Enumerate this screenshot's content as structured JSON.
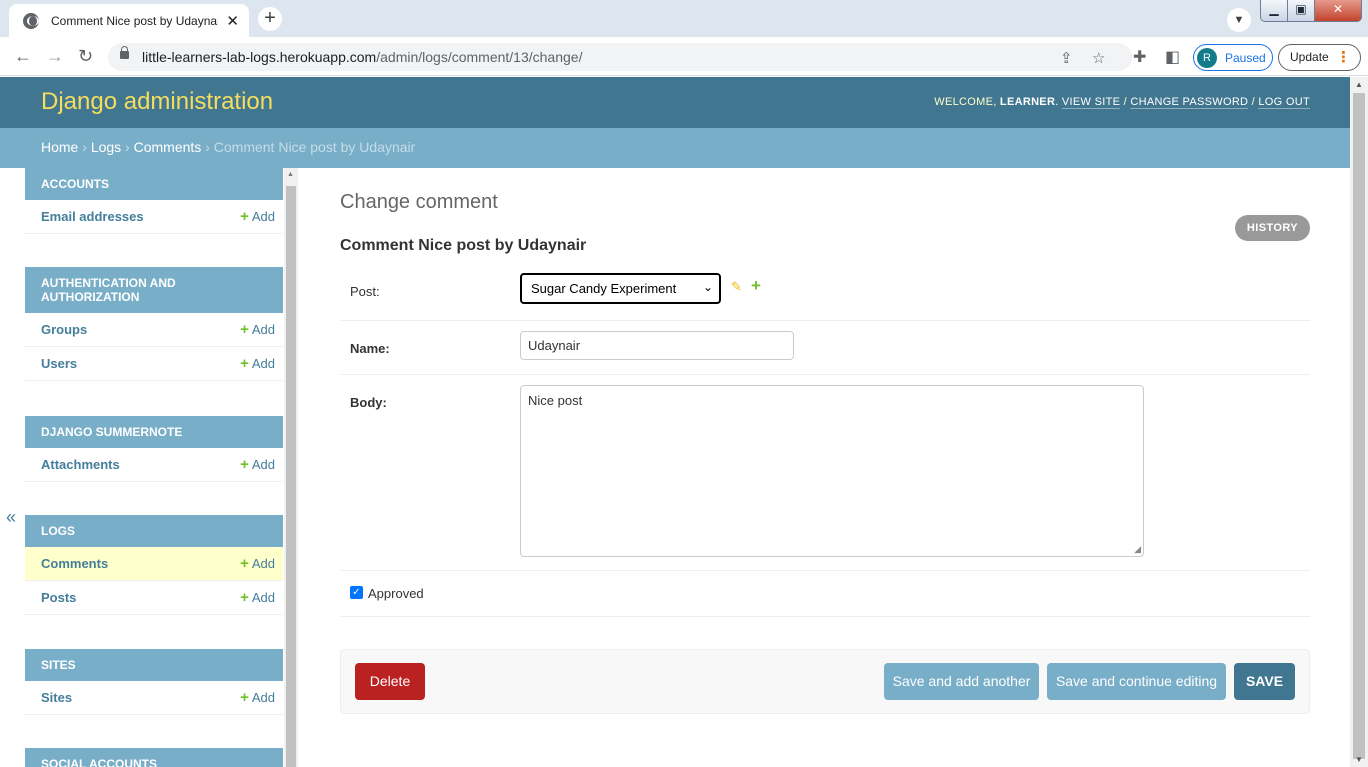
{
  "browser": {
    "tab_title": "Comment Nice post by Udaynair",
    "tab_close": "✕",
    "new_tab": "+",
    "url_host": "little-learners-lab-logs.herokuapp.com",
    "url_path": "/admin/logs/comment/13/change/",
    "profile_initial": "R",
    "profile_status": "Paused",
    "update_label": "Update"
  },
  "header": {
    "branding": "Django administration",
    "welcome": "WELCOME, ",
    "username": "LEARNER",
    "view_site": "VIEW SITE",
    "change_password": "CHANGE PASSWORD",
    "log_out": "LOG OUT",
    "sep": " / "
  },
  "breadcrumbs": {
    "home": "Home",
    "logs": "Logs",
    "comments": "Comments",
    "current": "Comment Nice post by Udaynair",
    "sep": " › "
  },
  "sidebar": {
    "collapse": "«",
    "add_label": "Add",
    "modules": [
      {
        "caption": "ACCOUNTS",
        "rows": [
          {
            "name": "Email addresses"
          }
        ]
      },
      {
        "caption": "AUTHENTICATION AND AUTHORIZATION",
        "rows": [
          {
            "name": "Groups"
          },
          {
            "name": "Users"
          }
        ]
      },
      {
        "caption": "DJANGO SUMMERNOTE",
        "rows": [
          {
            "name": "Attachments"
          }
        ]
      },
      {
        "caption": "LOGS",
        "rows": [
          {
            "name": "Comments"
          },
          {
            "name": "Posts"
          }
        ]
      },
      {
        "caption": "SITES",
        "rows": [
          {
            "name": "Sites"
          }
        ]
      },
      {
        "caption": "SOCIAL ACCOUNTS",
        "rows": []
      }
    ]
  },
  "main": {
    "title": "Change comment",
    "history": "HISTORY",
    "object_title": "Comment Nice post by Udaynair",
    "post_label": "Post:",
    "post_value": "Sugar Candy Experiment",
    "name_label": "Name:",
    "name_value": "Udaynair",
    "body_label": "Body:",
    "body_value": "Nice post",
    "approved_label": "Approved",
    "approved": true
  },
  "actions": {
    "delete": "Delete",
    "save_add_another": "Save and add another",
    "save_continue": "Save and continue editing",
    "save": "SAVE"
  }
}
